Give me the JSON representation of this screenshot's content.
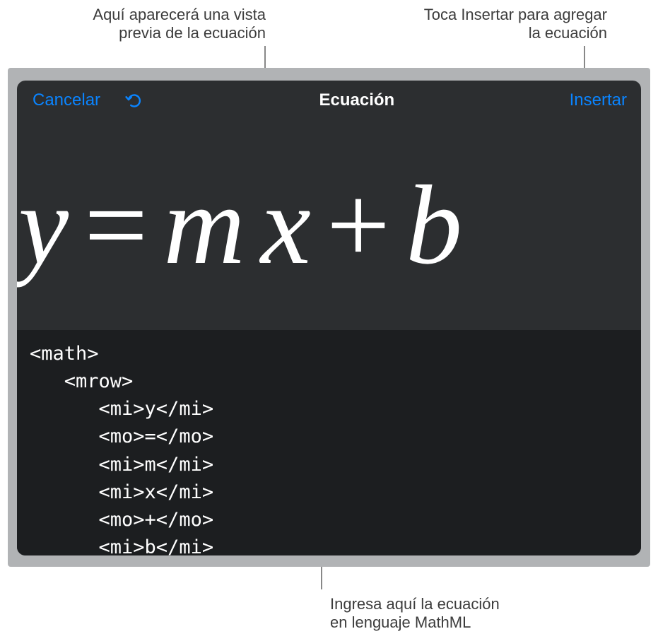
{
  "callouts": {
    "preview_line1": "Aquí aparecerá una vista",
    "preview_line2": "previa de la ecuación",
    "insert_line1": "Toca Insertar para agregar",
    "insert_line2": "la ecuación",
    "editor_line1": "Ingresa aquí la ecuación",
    "editor_line2": "en lenguaje MathML"
  },
  "titlebar": {
    "cancel": "Cancelar",
    "title": "Ecuación",
    "insert": "Insertar"
  },
  "preview": {
    "y": "y",
    "eq": "=",
    "m": "m",
    "x": "x",
    "plus": "+",
    "b": "b"
  },
  "editor": {
    "line1": "<math>",
    "line2": "   <mrow>",
    "line3": "      <mi>y</mi>",
    "line4": "      <mo>=</mo>",
    "line5": "      <mi>m</mi>",
    "line6": "      <mi>x</mi>",
    "line7": "      <mo>+</mo>",
    "line8": "      <mi>b</mi>"
  },
  "colors": {
    "accent": "#0a84ff",
    "panel": "#2c2e30",
    "editor_bg": "#1c1e20",
    "frame": "#b1b3b5"
  }
}
